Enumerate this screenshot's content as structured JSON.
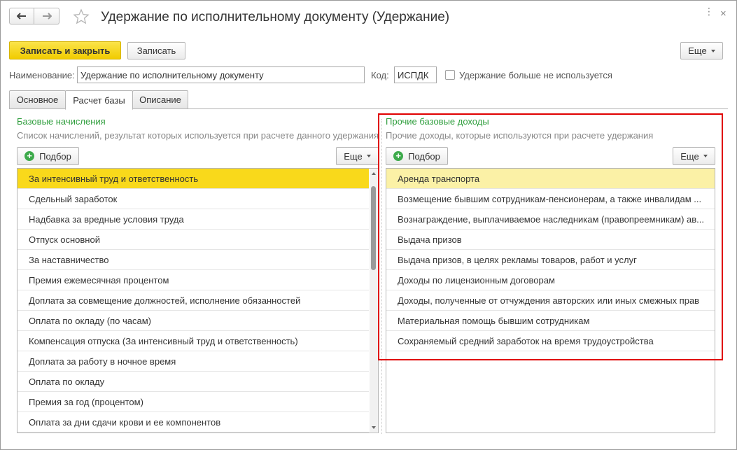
{
  "window": {
    "title": "Удержание по исполнительному документу (Удержание)",
    "more_glyph": "⋮",
    "close_glyph": "×"
  },
  "toolbar": {
    "save_close_label": "Записать и закрыть",
    "save_label": "Записать",
    "more_label": "Еще"
  },
  "form": {
    "name_label": "Наименование:",
    "name_value": "Удержание по исполнительному документу",
    "code_label": "Код:",
    "code_value": "ИСПДК",
    "unused_label": "Удержание больше не используется"
  },
  "tabs": [
    "Основное",
    "Расчет базы",
    "Описание"
  ],
  "left_panel": {
    "title": "Базовые начисления",
    "description": "Список начислений, результат которых используется при расчете данного удержания",
    "pick_label": "Подбор",
    "more_label": "Еще",
    "items": [
      "За интенсивный труд и ответственность",
      "Сдельный заработок",
      "Надбавка за вредные условия труда",
      "Отпуск основной",
      "За наставничество",
      "Премия ежемесячная процентом",
      "Доплата за совмещение должностей, исполнение обязанностей",
      "Оплата по окладу (по часам)",
      "Компенсация отпуска (За интенсивный труд и ответственность)",
      "Доплата за работу в ночное время",
      "Оплата по окладу",
      "Премия за год (процентом)",
      "Оплата за дни сдачи крови и ее компонентов"
    ]
  },
  "right_panel": {
    "title": "Прочие базовые доходы",
    "description": "Прочие доходы, которые используются при расчете удержания",
    "pick_label": "Подбор",
    "more_label": "Еще",
    "items": [
      "Аренда транспорта",
      "Возмещение бывшим сотрудникам-пенсионерам, а также инвалидам ...",
      "Вознаграждение, выплачиваемое наследникам (правопреемникам) ав...",
      "Выдача призов",
      "Выдача призов, в целях рекламы товаров, работ и услуг",
      "Доходы по лицензионным договорам",
      "Доходы, полученные от отчуждения авторских или иных смежных прав",
      "Материальная помощь бывшим сотрудникам",
      "Сохраняемый средний заработок на время трудоустройства"
    ]
  },
  "colors": {
    "accent_yellow": "#f9d91b",
    "group_title_green": "#2f9e3d",
    "highlight_red": "#e00000"
  }
}
